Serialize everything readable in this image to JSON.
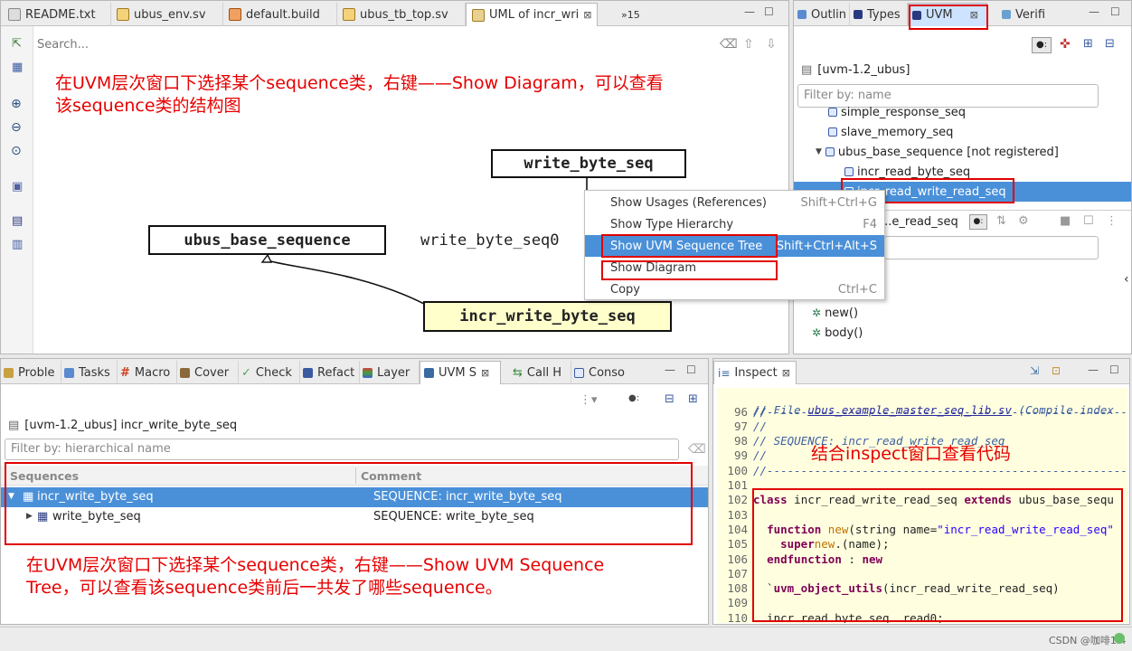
{
  "editor": {
    "tabs": [
      {
        "label": "README.txt"
      },
      {
        "label": "ubus_env.sv"
      },
      {
        "label": "default.build"
      },
      {
        "label": "ubus_tb_top.sv"
      },
      {
        "label": "UML of incr_wri"
      }
    ],
    "overflow": "»15",
    "search_placeholder": "Search...",
    "annotation": "在UVM层次窗口下选择某个sequence类，右键——Show  Diagram，可以查看该sequence类的结构图",
    "uml": {
      "box_top": "write_byte_seq",
      "box_left": "ubus_base_sequence",
      "box_bottom": "incr_write_byte_seq",
      "relation_label": "write_byte_seq0"
    }
  },
  "context_menu": {
    "items": [
      {
        "label": "Show Usages (References)",
        "shortcut": "Shift+Ctrl+G"
      },
      {
        "label": "Show Type Hierarchy",
        "shortcut": "F4"
      },
      {
        "label": "Show UVM Sequence Tree",
        "shortcut": "Shift+Ctrl+Alt+S"
      },
      {
        "label": "Show Diagram",
        "shortcut": ""
      },
      {
        "label": "Copy",
        "shortcut": "Ctrl+C"
      }
    ]
  },
  "uvm_view": {
    "tabs": [
      {
        "label": "Outlin"
      },
      {
        "label": "Types"
      },
      {
        "label": "UVM"
      },
      {
        "label": "Verifi"
      }
    ],
    "root": "[uvm-1.2_ubus]",
    "filter_placeholder": "Filter by: name",
    "tree": [
      {
        "label": "simple_response_seq"
      },
      {
        "label": "slave_memory_seq"
      },
      {
        "label": "ubus_base_sequence [not registered]"
      },
      {
        "label": "incr_read_byte_seq"
      },
      {
        "label": "incr_read_write_read_seq"
      }
    ],
    "sub_label": "...e_read_seq",
    "members": [
      {
        "label": "new()"
      },
      {
        "label": "body()"
      }
    ]
  },
  "bottom_view": {
    "tabs": [
      {
        "label": "Proble"
      },
      {
        "label": "Tasks"
      },
      {
        "label": "Macro"
      },
      {
        "label": "Cover"
      },
      {
        "label": "Check"
      },
      {
        "label": "Refact"
      },
      {
        "label": "Layer"
      },
      {
        "label": "UVM S"
      },
      {
        "label": "Call H"
      },
      {
        "label": "Conso"
      }
    ],
    "root": "[uvm-1.2_ubus] incr_write_byte_seq",
    "filter_placeholder": "Filter by: hierarchical name",
    "columns": {
      "sequences": "Sequences",
      "comment": "Comment"
    },
    "rows": [
      {
        "name": "incr_write_byte_seq",
        "comment": "SEQUENCE: incr_write_byte_seq"
      },
      {
        "name": "write_byte_seq",
        "comment": "SEQUENCE: write_byte_seq"
      }
    ],
    "annotation": "在UVM层次窗口下选择某个sequence类，右键——Show  UVM  Sequence Tree，可以查看该sequence类前后一共发了哪些sequence。"
  },
  "inspect": {
    "tab": "Inspect",
    "annotation": "结合inspect窗口查看代码",
    "header": {
      "pre": "// File ",
      "file": "ubus_example_master_seq_lib.sv",
      "post": " (Compile index"
    },
    "lines": [
      {
        "n": "96",
        "t": "//----------------------------------------------------------"
      },
      {
        "n": "97",
        "t": "//"
      },
      {
        "n": "98",
        "t": "// SEQUENCE: incr_read_write_read_seq"
      },
      {
        "n": "99",
        "t": "//"
      },
      {
        "n": "100",
        "t": "//----------------------------------------------------------"
      },
      {
        "n": "101",
        "t": ""
      },
      {
        "n": "102",
        "kw": "class",
        "a": " incr_read_write_read_seq ",
        "kw2": "extends",
        "b": " ubus_base_sequ"
      },
      {
        "n": "103",
        "t": ""
      },
      {
        "n": "104",
        "pre": "  ",
        "kw": "function",
        "fn": " new",
        "a": "(string name=",
        "st": "\"incr_read_write_read_seq\""
      },
      {
        "n": "105",
        "pre": "    ",
        "kw": "super",
        "a": ".",
        "fn": "new",
        "b": "(name);"
      },
      {
        "n": "106",
        "pre": "  ",
        "kw": "endfunction",
        "a": " : ",
        "kw2": "new"
      },
      {
        "n": "107",
        "t": ""
      },
      {
        "n": "108",
        "pre": "  `",
        "kw": "uvm_object_utils",
        "a": "(incr_read_write_read_seq)"
      },
      {
        "n": "109",
        "t": ""
      },
      {
        "n": "110",
        "a": "  incr_read_byte_seq  read0;"
      }
    ]
  },
  "status": {
    "text": "CSDN @咖啡1.4"
  },
  "colors": {
    "accent": "#e00000",
    "selection": "#4a90d9",
    "uml_highlight": "#ffffcc"
  }
}
